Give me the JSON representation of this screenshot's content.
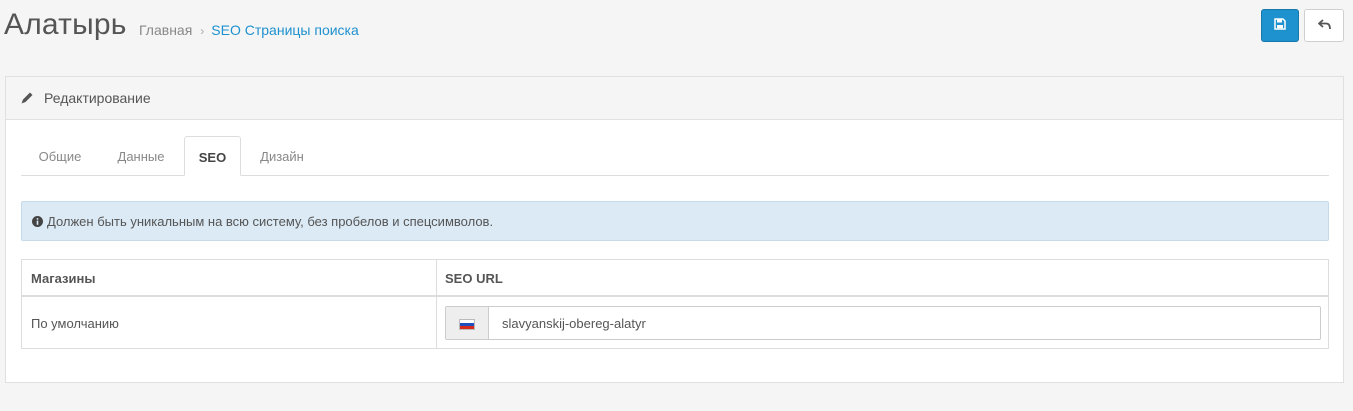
{
  "header": {
    "title": "Алатырь",
    "breadcrumb": [
      {
        "label": "Главная"
      },
      {
        "label": "SEO Страницы поиска"
      }
    ],
    "breadcrumb_separator": "›",
    "buttons": {
      "save_icon": "save-icon",
      "back_icon": "reply-icon"
    }
  },
  "panel": {
    "title": "Редактирование",
    "title_icon": "pencil-icon",
    "tabs": [
      {
        "label": "Общие",
        "active": false
      },
      {
        "label": "Данные",
        "active": false
      },
      {
        "label": "SEO",
        "active": true
      },
      {
        "label": "Дизайн",
        "active": false
      }
    ],
    "alert": {
      "icon": "info-circle-icon",
      "text": "Должен быть уникальным на всю систему, без пробелов и спецсимволов."
    },
    "table": {
      "headers": [
        "Магазины",
        "SEO URL"
      ],
      "rows": [
        {
          "store": "По умолчанию",
          "language_flag": "russian-flag-icon",
          "seo_url": "slavyanskij-obereg-alatyr"
        }
      ]
    }
  },
  "colors": {
    "accent": "#1e91cf",
    "alert_bg": "#dbeaf5",
    "page_bg": "#f5f5f5"
  }
}
